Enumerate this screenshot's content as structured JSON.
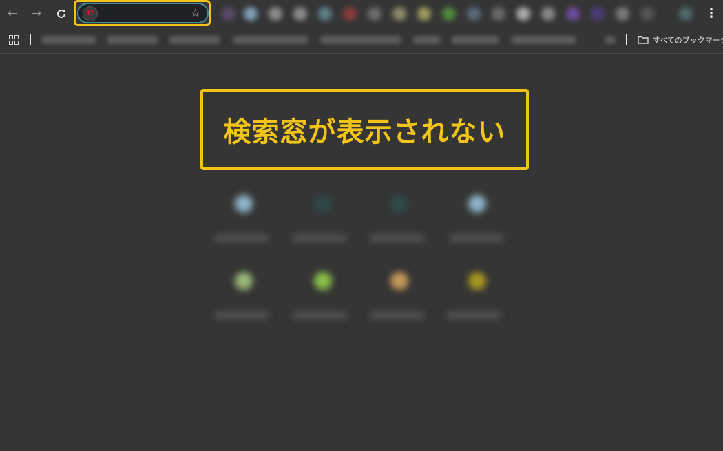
{
  "toolbar": {
    "back_icon": "arrow-left-icon",
    "forward_icon": "arrow-right-icon",
    "reload_icon": "reload-icon",
    "site_icon_text": "Y!",
    "star_icon": "star-icon",
    "menu_icon": "kebab-menu-icon"
  },
  "bookmarks_bar": {
    "apps_icon": "apps-grid-icon",
    "all_bookmarks_label": "すべてのブックマーク"
  },
  "annotation": {
    "text": "検索窓が表示されない"
  },
  "colors": {
    "background": "#353535",
    "highlight": "#f2c418",
    "omnibox": "#202124",
    "omnibox_border": "#3f8f9c"
  }
}
